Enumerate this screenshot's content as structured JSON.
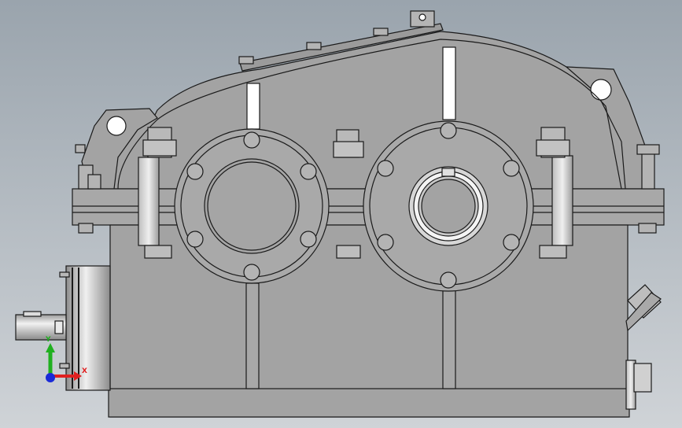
{
  "viewport": {
    "background_top": "#9aa4ad",
    "background_bottom": "#cfd3d7"
  },
  "model": {
    "body_color": "#a3a3a3",
    "edge_color": "#1a1a1a",
    "highlight_color": "#ffffff"
  },
  "triad": {
    "x_label": "X",
    "y_label": "Y",
    "x_color": "#e02020",
    "y_color": "#20b020",
    "z_color": "#1a2ad8"
  }
}
